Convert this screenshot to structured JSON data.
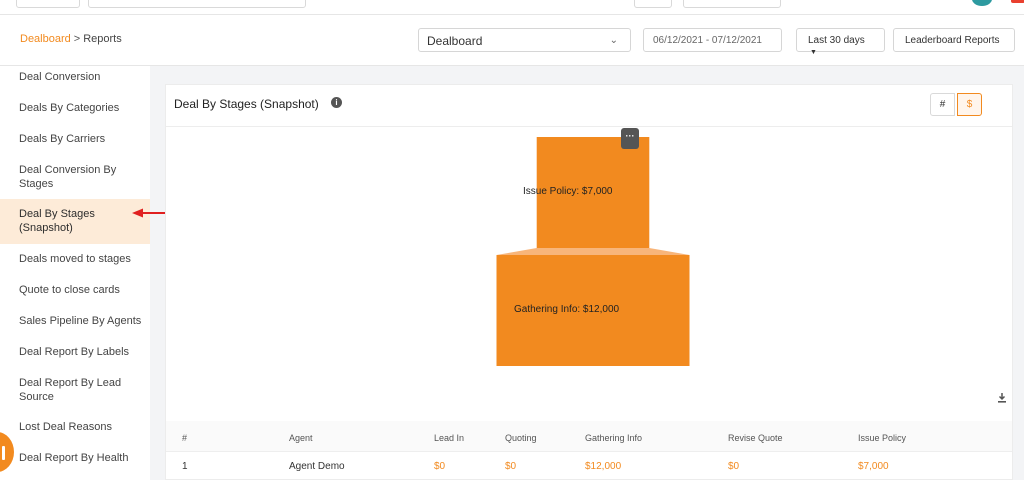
{
  "breadcrumb": {
    "root": "Dealboard",
    "separator": ">",
    "current": "Reports"
  },
  "filters": {
    "dashboard_select": "Dealboard",
    "date_range": "06/12/2021 - 07/12/2021",
    "period": "Last 30 days",
    "leaderboard_button": "Leaderboard Reports"
  },
  "sidebar": {
    "items": [
      {
        "label": "Deal Conversion",
        "active": false
      },
      {
        "label": "Deals By Categories",
        "active": false
      },
      {
        "label": "Deals By Carriers",
        "active": false
      },
      {
        "label": "Deal Conversion By Stages",
        "active": false
      },
      {
        "label": "Deal By Stages (Snapshot)",
        "active": true
      },
      {
        "label": "Deals moved to stages",
        "active": false
      },
      {
        "label": "Quote to close cards",
        "active": false
      },
      {
        "label": "Sales Pipeline By Agents",
        "active": false
      },
      {
        "label": "Deal Report By Labels",
        "active": false
      },
      {
        "label": "Deal Report By Lead Source",
        "active": false
      },
      {
        "label": "Lost Deal Reasons",
        "active": false
      },
      {
        "label": "Deal Report By Health",
        "active": false
      }
    ]
  },
  "card": {
    "title": "Deal By Stages (Snapshot)",
    "toggle": {
      "count": "#",
      "amount": "$",
      "selected": "amount"
    },
    "menu_label": "···"
  },
  "chart_data": {
    "type": "funnel",
    "title": "",
    "stages": [
      {
        "label": "Issue Policy: $7,000",
        "stage": "Issue Policy",
        "value": 7000
      },
      {
        "label": "Gathering Info: $12,000",
        "stage": "Gathering Info",
        "value": 12000
      }
    ],
    "color": "#f28a1f"
  },
  "table": {
    "headers": [
      "#",
      "Agent",
      "Lead In",
      "Quoting",
      "Gathering Info",
      "Revise Quote",
      "Issue Policy"
    ],
    "rows": [
      [
        "1",
        "Agent Demo",
        "$0",
        "$0",
        "$12,000",
        "$0",
        "$7,000"
      ]
    ]
  },
  "colors": {
    "accent": "#f28a1f",
    "active_bg": "#fdebd8",
    "annotation_arrow": "#e02020"
  }
}
